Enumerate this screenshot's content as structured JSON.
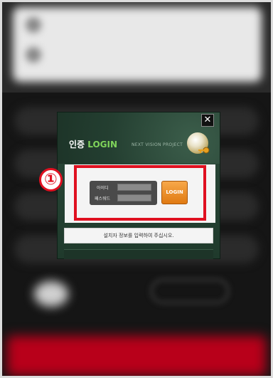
{
  "dialog": {
    "close_label": "✕",
    "title_prefix": "인증 ",
    "title_accent": "LOGIN",
    "project_label": "NEXT VISION PROJECT",
    "id_label": "아이디",
    "password_label": "패스워드",
    "login_button": "LOGIN",
    "notice": "설치자 정보를 입력하여 주십시오."
  },
  "annotation": {
    "step_number": "①"
  },
  "colors": {
    "highlight": "#e01020",
    "accent_green": "#7fd35a",
    "login_orange": "#e07a12"
  }
}
